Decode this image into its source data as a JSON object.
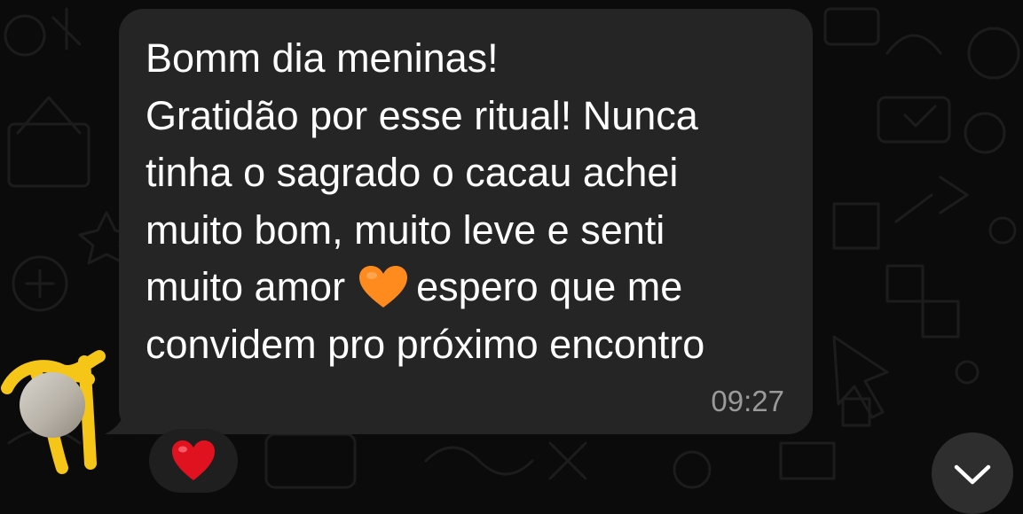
{
  "chat": {
    "message": {
      "lines": [
        "Bomm dia meninas!",
        "Gratidão por esse ritual! Nunca",
        "tinha o sagrado o cacau achei",
        "muito bom, muito leve e senti",
        "muito amor",
        "espero que me",
        "convidem pro próximo encontro"
      ],
      "inline_emoji": "orange-heart",
      "time": "09:27"
    },
    "reaction": {
      "emoji": "red-heart"
    },
    "scroll_button_icon": "chevron-down-icon"
  },
  "colors": {
    "background": "#0b0b0b",
    "bubble": "#252525",
    "text": "#ffffff",
    "timestamp": "#9a9a9a",
    "orange_heart": "#ff8a1e",
    "red_heart": "#e0121f",
    "scribble": "#f5c518"
  }
}
